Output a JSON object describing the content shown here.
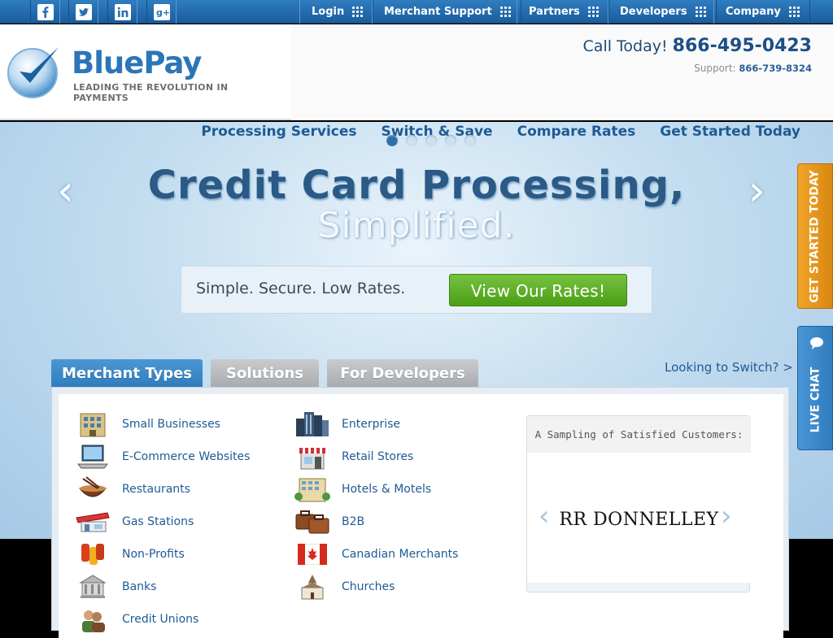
{
  "topbar": {
    "social": [
      "facebook-icon",
      "twitter-icon",
      "linkedin-icon",
      "googleplus-icon"
    ],
    "nav": [
      {
        "label": "Login"
      },
      {
        "label": "Merchant Support"
      },
      {
        "label": "Partners"
      },
      {
        "label": "Developers"
      },
      {
        "label": "Company"
      }
    ]
  },
  "header": {
    "brand": "BluePay",
    "tagline": "LEADING THE REVOLUTION IN PAYMENTS",
    "call_label": "Call Today!",
    "call_number": "866-495-0423",
    "support_label": "Support:",
    "support_number": "866-739-8324"
  },
  "hero": {
    "nav": [
      "Processing Services",
      "Switch & Save",
      "Compare Rates",
      "Get Started Today"
    ],
    "slide_count": 5,
    "active_slide": 1,
    "title": "Credit Card Processing,",
    "subtitle": "Simplified.",
    "cta_text": "Simple. Secure. Low Rates.",
    "cta_button": "View Our Rates!"
  },
  "tabs": [
    "Merchant Types",
    "Solutions",
    "For Developers"
  ],
  "switch_link": "Looking to Switch? >",
  "merchants_left": [
    "Small Businesses",
    "E-Commerce Websites",
    "Restaurants",
    "Gas Stations",
    "Non-Profits",
    "Banks",
    "Credit Unions"
  ],
  "merchants_right": [
    "Enterprise",
    "Retail Stores",
    "Hotels & Motels",
    "B2B",
    "Canadian Merchants",
    "Churches"
  ],
  "customers": {
    "title": "A Sampling of Satisfied Customers:",
    "logo_text": "RR DONNELLEY"
  },
  "side": {
    "get_started": "GET STARTED TODAY",
    "live_chat": "LIVE CHAT"
  },
  "colors": {
    "brand": "#2b75b8",
    "accent_green": "#5aad26",
    "side_orange": "#e89518",
    "side_blue": "#3a86c8"
  }
}
